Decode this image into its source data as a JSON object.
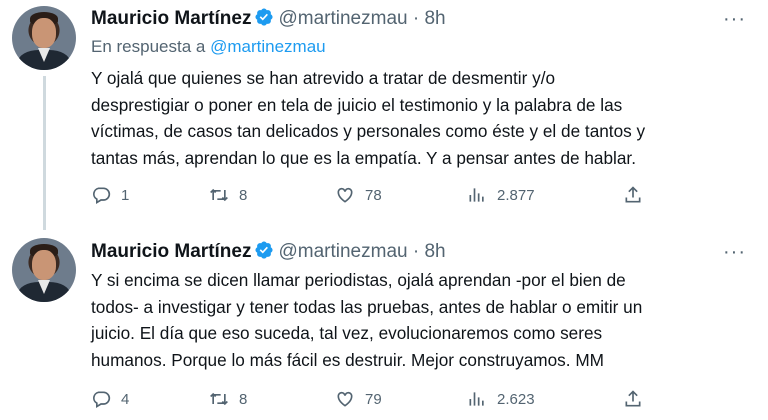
{
  "colors": {
    "link": "#1d9bf0",
    "muted": "#536471",
    "text": "#0f1419",
    "verified": "#1d9bf0"
  },
  "tweets": [
    {
      "author_name": "Mauricio Martínez",
      "handle": "@martinezmau",
      "separator": "·",
      "time": "8h",
      "reply_prefix": "En respuesta a",
      "reply_mention": "@martinezmau",
      "lines": [
        "Y ojalá que quienes se han atrevido a tratar de desmentir y/o",
        "desprestigiar o poner en tela de juicio el testimonio y la palabra de las",
        "víctimas, de casos tan delicados y personales como éste y el de tantos y",
        "tantas más, aprendan lo que es la empatía. Y a pensar antes de hablar."
      ],
      "replies": "1",
      "retweets": "8",
      "likes": "78",
      "views": "2.877",
      "more": "···"
    },
    {
      "author_name": "Mauricio Martínez",
      "handle": "@martinezmau",
      "separator": "·",
      "time": "8h",
      "lines": [
        "Y si encima se dicen llamar periodistas, ojalá aprendan -por el bien de",
        "todos- a investigar y tener todas las pruebas, antes de hablar o emitir un",
        "juicio. El día que eso suceda, tal vez, evolucionaremos como seres",
        "humanos. Porque lo más fácil es destruir. Mejor construyamos. MM"
      ],
      "replies": "4",
      "retweets": "8",
      "likes": "79",
      "views": "2.623",
      "more": "···"
    }
  ],
  "icons": [
    "reply-icon",
    "retweet-icon",
    "like-icon",
    "views-icon",
    "share-icon",
    "verified-icon",
    "more-icon"
  ]
}
